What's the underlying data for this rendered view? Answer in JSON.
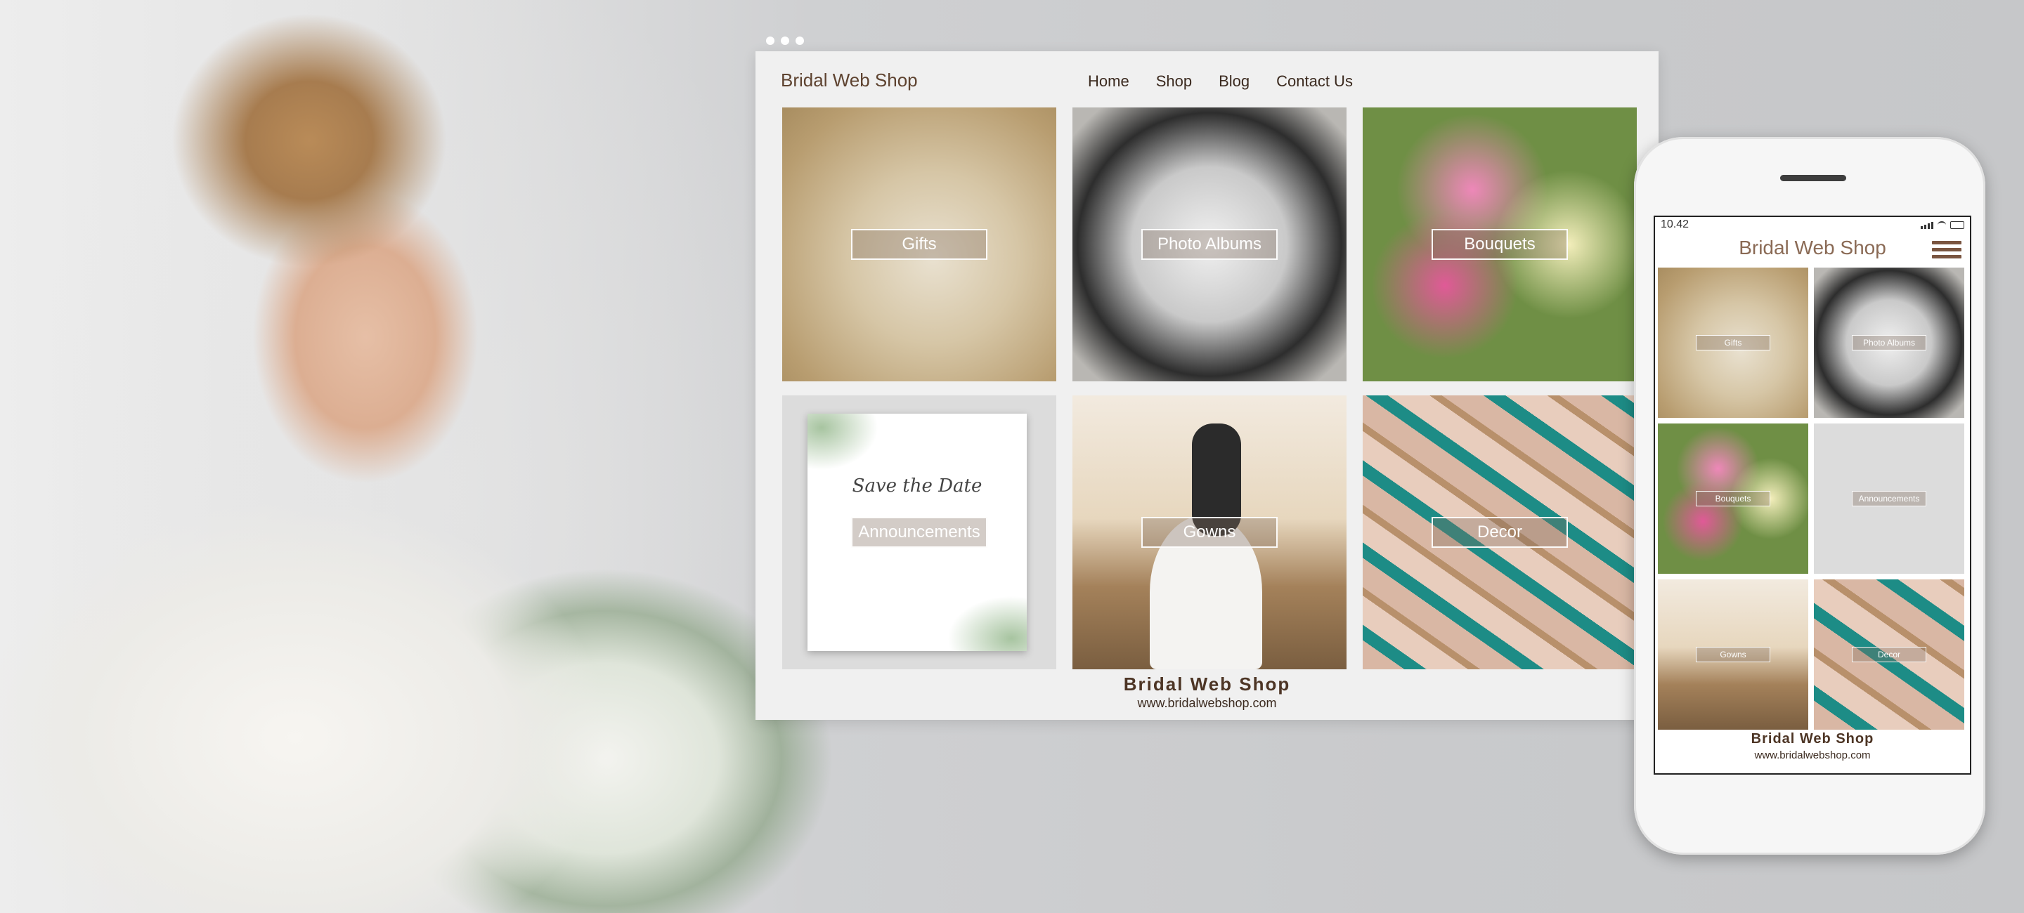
{
  "browser": {
    "brand": "Bridal Web Shop",
    "nav": [
      "Home",
      "Shop",
      "Blog",
      "Contact Us"
    ],
    "tiles": [
      "Gifts",
      "Photo Albums",
      "Bouquets",
      "Announcements",
      "Gowns",
      "Decor"
    ],
    "card_text": "Save the Date",
    "footer_brand": "Bridal Web Shop",
    "footer_url": "www.bridalwebshop.com"
  },
  "mobile": {
    "time": "10.42",
    "brand": "Bridal Web Shop",
    "tiles": [
      "Gifts",
      "Photo Albums",
      "Bouquets",
      "Announcements",
      "Gowns",
      "Decor"
    ],
    "footer_brand": "Bridal Web Shop",
    "footer_url": "www.bridalwebshop.com"
  },
  "icons": [
    "menu-icon",
    "signal-icon",
    "wifi-icon",
    "battery-icon"
  ],
  "colors": {
    "brand_brown": "#5e4330",
    "accent_teal": "#1d8c86"
  }
}
